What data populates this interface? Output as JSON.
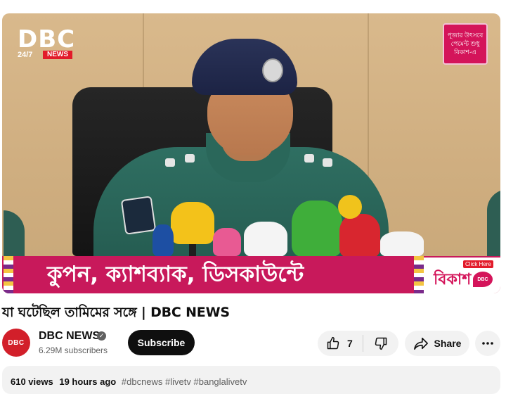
{
  "video": {
    "logo_main": "DBC",
    "logo_sub": "24/7",
    "logo_news": "NEWS",
    "corner_ad_lines": [
      "পূজার উৎসবে",
      "পেমেন্ট শুধু",
      "বিকাশ-এ"
    ],
    "ad_banner_text": "কুপন, ক্যাশব্যাক, ডিসকাউন্টে",
    "ad_brand": "বিকাশ",
    "ad_click": "Click Here",
    "ad_brand_logo": "DBC"
  },
  "title": "যা ঘটেছিল তামিমের সঙ্গে | DBC NEWS",
  "channel": {
    "avatar_text": "DBC",
    "name": "DBC NEWS",
    "verified_icon": "verified-check-icon",
    "subscribers": "6.29M subscribers",
    "subscribe_label": "Subscribe"
  },
  "actions": {
    "like_count": "7",
    "share_label": "Share",
    "icons": [
      "thumb-up-icon",
      "thumb-down-icon",
      "share-arrow-icon",
      "more-dots-icon"
    ]
  },
  "description": {
    "views": "610 views",
    "age": "19 hours ago",
    "tags": "#dbcnews #livetv #banglalivetv"
  },
  "colors": {
    "subscribe_bg": "#0f0f0f",
    "avatar_red": "#d21f2a",
    "ad_pink": "#c8195b"
  }
}
